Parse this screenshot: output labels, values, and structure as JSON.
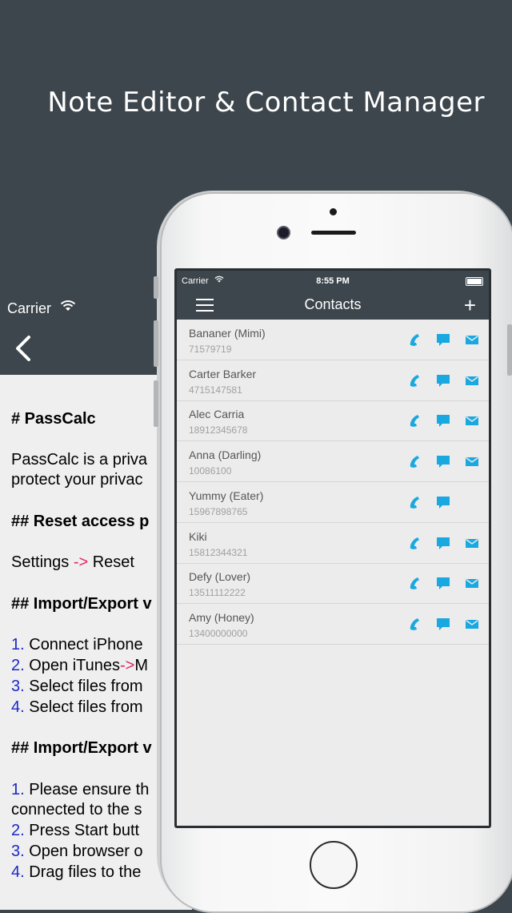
{
  "headline": "Note Editor & Contact Manager",
  "back_phone": {
    "carrier": "Carrier",
    "lines": [
      {
        "parts": [
          {
            "t": "# PassCalc",
            "c": "bold"
          }
        ]
      },
      {
        "parts": [
          {
            "t": "PassCalc is a priva",
            "c": ""
          }
        ]
      },
      {
        "parts": [
          {
            "t": "protect your privac",
            "c": ""
          }
        ]
      },
      {
        "parts": [
          {
            "t": "## Reset access p",
            "c": "bold"
          }
        ]
      },
      {
        "parts": [
          {
            "t": "Settings ",
            "c": ""
          },
          {
            "t": "->",
            "c": "arr"
          },
          {
            "t": " Reset",
            "c": ""
          }
        ]
      },
      {
        "parts": [
          {
            "t": "## Import/Export v",
            "c": "bold"
          }
        ]
      },
      {
        "parts": [
          {
            "t": "1.",
            "c": "num"
          },
          {
            "t": " Connect iPhone",
            "c": ""
          }
        ]
      },
      {
        "parts": [
          {
            "t": "2.",
            "c": "num"
          },
          {
            "t": " Open iTunes",
            "c": ""
          },
          {
            "t": "->",
            "c": "arr"
          },
          {
            "t": "M",
            "c": ""
          }
        ]
      },
      {
        "parts": [
          {
            "t": "3.",
            "c": "num"
          },
          {
            "t": " Select files from",
            "c": ""
          }
        ]
      },
      {
        "parts": [
          {
            "t": "4.",
            "c": "num"
          },
          {
            "t": " Select files from",
            "c": ""
          }
        ]
      },
      {
        "parts": [
          {
            "t": "## Import/Export v",
            "c": "bold"
          }
        ]
      },
      {
        "parts": [
          {
            "t": "1.",
            "c": "num"
          },
          {
            "t": " Please ensure th",
            "c": ""
          }
        ]
      },
      {
        "parts": [
          {
            "t": "connected to the s",
            "c": ""
          }
        ]
      },
      {
        "parts": [
          {
            "t": "2.",
            "c": "num"
          },
          {
            "t": " Press Start butt",
            "c": ""
          }
        ]
      },
      {
        "parts": [
          {
            "t": "3.",
            "c": "num"
          },
          {
            "t": " Open browser o",
            "c": ""
          }
        ]
      },
      {
        "parts": [
          {
            "t": "4.",
            "c": "num"
          },
          {
            "t": " Drag files to the",
            "c": ""
          }
        ]
      }
    ]
  },
  "status_bar": {
    "carrier": "Carrier",
    "time": "8:55 PM"
  },
  "nav": {
    "title": "Contacts",
    "add": "+"
  },
  "contacts": [
    {
      "name": "Bananer (Mimi)",
      "phone": "71579719",
      "mail": true
    },
    {
      "name": "Carter Barker",
      "phone": "4715147581",
      "mail": true
    },
    {
      "name": "Alec Carria",
      "phone": "18912345678",
      "mail": true
    },
    {
      "name": "Anna (Darling)",
      "phone": "10086100",
      "mail": true
    },
    {
      "name": "Yummy (Eater)",
      "phone": "15967898765",
      "mail": false
    },
    {
      "name": "Kiki",
      "phone": "15812344321",
      "mail": true
    },
    {
      "name": "Defy (Lover)",
      "phone": "13511112222",
      "mail": true
    },
    {
      "name": "Amy (Honey)",
      "phone": "13400000000",
      "mail": true
    }
  ],
  "colors": {
    "accent": "#1aa8e0",
    "bar": "#3c464c"
  }
}
